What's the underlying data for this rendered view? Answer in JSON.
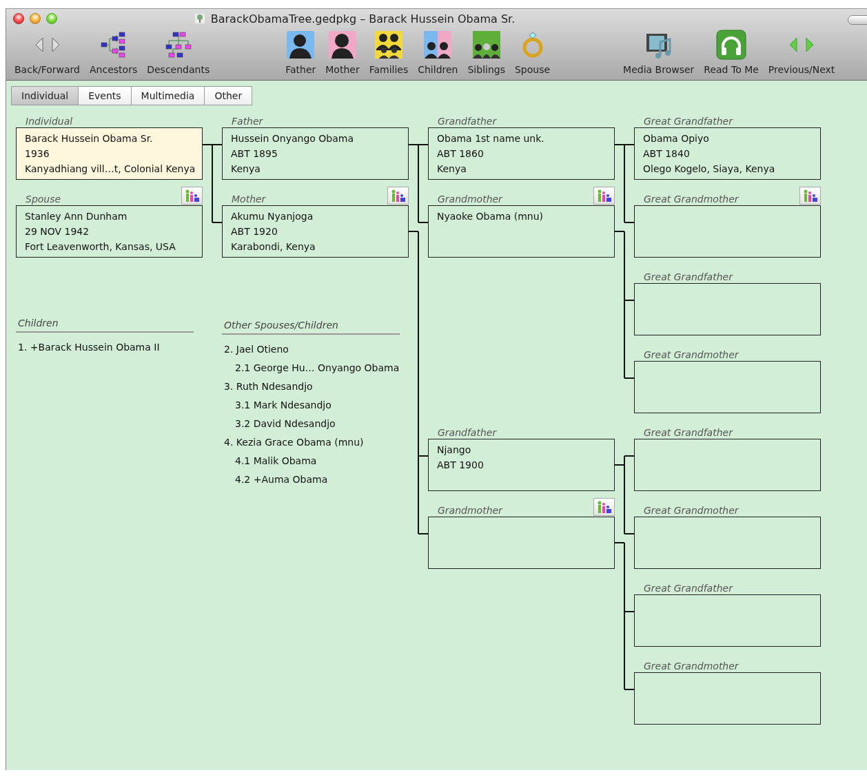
{
  "window": {
    "title": "BarackObamaTree.gedpkg – Barack Hussein Obama Sr."
  },
  "toolbar": {
    "groups": [
      [
        {
          "kind": "back-forward",
          "label": "Back/Forward"
        },
        {
          "kind": "ancestors",
          "label": "Ancestors"
        },
        {
          "kind": "descendants",
          "label": "Descendants"
        }
      ],
      [
        {
          "kind": "father",
          "label": "Father"
        },
        {
          "kind": "mother",
          "label": "Mother"
        },
        {
          "kind": "families",
          "label": "Families"
        },
        {
          "kind": "children",
          "label": "Children"
        },
        {
          "kind": "siblings",
          "label": "Siblings"
        },
        {
          "kind": "spouse",
          "label": "Spouse"
        }
      ],
      [
        {
          "kind": "media",
          "label": "Media Browser"
        },
        {
          "kind": "read",
          "label": "Read To Me"
        },
        {
          "kind": "prev-next",
          "label": "Previous/Next"
        }
      ]
    ]
  },
  "tabs": [
    {
      "label": "Individual",
      "selected": true
    },
    {
      "label": "Events",
      "selected": false
    },
    {
      "label": "Multimedia",
      "selected": false
    },
    {
      "label": "Other",
      "selected": false
    }
  ],
  "pedigree": {
    "individual": {
      "label": "Individual",
      "lines": [
        "Barack Hussein Obama Sr.",
        "1936",
        "Kanyadhiang vill…t, Colonial Kenya"
      ],
      "selected": true,
      "family_icon": false
    },
    "spouse": {
      "label": "Spouse",
      "lines": [
        "Stanley Ann Dunham",
        "29 NOV 1942",
        "Fort Leavenworth, Kansas, USA"
      ],
      "selected": false,
      "family_icon": true
    },
    "parents": [
      {
        "label": "Father",
        "lines": [
          "Hussein Onyango Obama",
          "ABT 1895",
          "Kenya"
        ],
        "selected": false,
        "family_icon": false
      },
      {
        "label": "Mother",
        "lines": [
          "Akumu Nyanjoga",
          "ABT 1920",
          "Karabondi, Kenya"
        ],
        "selected": false,
        "family_icon": true
      }
    ],
    "grandparents": [
      {
        "label": "Grandfather",
        "lines": [
          "Obama 1st name unk.",
          "ABT 1860",
          "Kenya"
        ],
        "selected": false,
        "family_icon": false
      },
      {
        "label": "Grandmother",
        "lines": [
          "Nyaoke Obama (mnu)"
        ],
        "selected": false,
        "family_icon": true
      },
      {
        "label": "Grandfather",
        "lines": [
          "Njango",
          "ABT 1900"
        ],
        "selected": false,
        "family_icon": false
      },
      {
        "label": "Grandmother",
        "selected": false,
        "family_icon": true
      }
    ],
    "great_grandparents": [
      {
        "label": "Great Grandfather",
        "lines": [
          "Obama Opiyo",
          "ABT 1840",
          "Olego Kogelo, Siaya, Kenya"
        ],
        "selected": false,
        "family_icon": false
      },
      {
        "label": "Great Grandmother",
        "selected": false,
        "family_icon": true
      },
      {
        "label": "Great Grandfather",
        "selected": false,
        "family_icon": false
      },
      {
        "label": "Great Grandmother",
        "selected": false,
        "family_icon": false
      },
      {
        "label": "Great Grandfather",
        "selected": false,
        "family_icon": false
      },
      {
        "label": "Great Grandmother",
        "selected": false,
        "family_icon": false
      },
      {
        "label": "Great Grandfather",
        "selected": false,
        "family_icon": false
      },
      {
        "label": "Great Grandmother",
        "selected": false,
        "family_icon": false
      }
    ]
  },
  "children": {
    "title": "Children",
    "items": [
      {
        "text": "1. +Barack Hussein Obama II"
      }
    ]
  },
  "other_spouses": {
    "title": "Other Spouses/Children",
    "items": [
      {
        "text": "2. Jael Otieno",
        "children": [
          {
            "text": "2.1 George Hu… Onyango Obama"
          }
        ]
      },
      {
        "text": "3. Ruth Ndesandjo",
        "children": [
          {
            "text": "3.1 Mark Ndesandjo"
          },
          {
            "text": "3.2 David Ndesandjo"
          }
        ]
      },
      {
        "text": "4. Kezia Grace Obama (mnu)",
        "children": [
          {
            "text": "4.1 Malik Obama"
          },
          {
            "text": "4.2 +Auma Obama"
          }
        ]
      }
    ]
  }
}
